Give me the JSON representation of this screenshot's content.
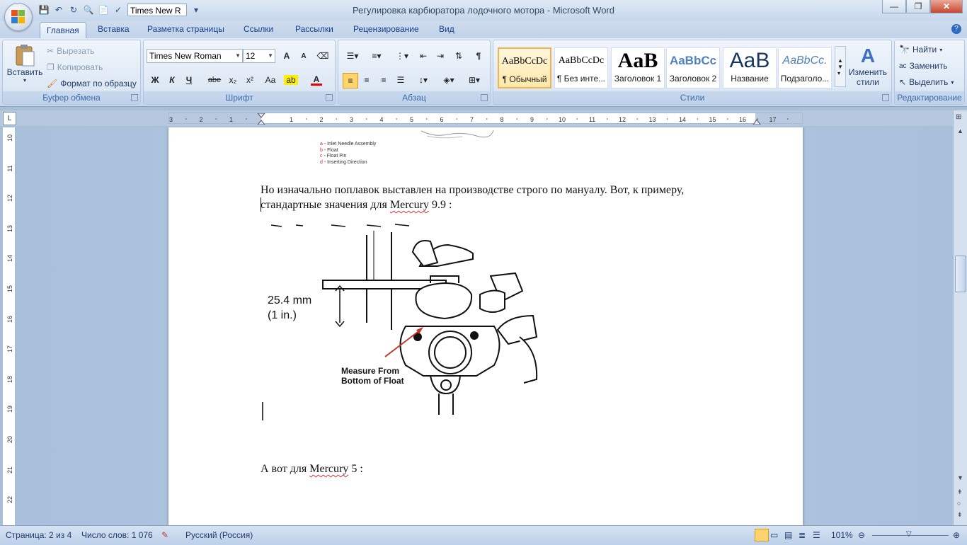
{
  "window": {
    "title": "Регулировка карбюратора лодочного мотора - Microsoft Word",
    "qat_font": "Times New R",
    "controls": [
      "—",
      "❐",
      "✕"
    ]
  },
  "tabs": [
    "Главная",
    "Вставка",
    "Разметка страницы",
    "Ссылки",
    "Рассылки",
    "Рецензирование",
    "Вид"
  ],
  "clipboard": {
    "paste": "Вставить",
    "cut": "Вырезать",
    "copy": "Копировать",
    "format_painter": "Формат по образцу",
    "label": "Буфер обмена"
  },
  "font": {
    "name": "Times New Roman",
    "size": "12",
    "bold": "Ж",
    "italic": "К",
    "underline": "Ч",
    "strike": "abe",
    "subscript": "x₂",
    "superscript": "x²",
    "case": "Aa",
    "grow": "A",
    "shrink": "A",
    "color_letter": "A",
    "label": "Шрифт"
  },
  "paragraph": {
    "label": "Абзац",
    "pilcrow": "¶"
  },
  "styles": {
    "items": [
      {
        "preview": "AaBbCcDc",
        "name": "¶ Обычный"
      },
      {
        "preview": "AaBbCcDc",
        "name": "¶ Без инте..."
      },
      {
        "preview": "AaB",
        "name": "Заголовок 1"
      },
      {
        "preview": "AaBbCc",
        "name": "Заголовок 2"
      },
      {
        "preview": "AaB",
        "name": "Название"
      },
      {
        "preview": "AaBbCc.",
        "name": "Подзаголо..."
      }
    ],
    "change": "Изменить стили",
    "label": "Стили"
  },
  "editing": {
    "find": "Найти",
    "replace": "Заменить",
    "select": "Выделить",
    "label": "Редактирование"
  },
  "ruler": {
    "h_numbers": [
      "3",
      "2",
      "1",
      "1",
      "2",
      "3",
      "4",
      "5",
      "6",
      "7",
      "8",
      "9",
      "10",
      "11",
      "12",
      "13",
      "14",
      "15",
      "16",
      "17"
    ],
    "v_numbers": [
      "10",
      "11",
      "12",
      "13",
      "14",
      "15",
      "16",
      "17",
      "18",
      "19",
      "20",
      "21",
      "22"
    ]
  },
  "document": {
    "legend": [
      "a - Inlet Needle Assembly",
      "b - Float",
      "c - Float Pin",
      "d - Inserting Direction"
    ],
    "legend_letters": [
      "a",
      "b",
      "c",
      "d"
    ],
    "legend_texts": [
      "- Inlet Needle Assembly",
      "- Float",
      "- Float Pin",
      "- Inserting Direction"
    ],
    "para1_line1": "Но изначально поплавок выставлен на производстве строго по мануалу. Вот, к примеру,",
    "para1_line2_pre": "стандартные значения для ",
    "para1_brand": "Mercury",
    "para1_line2_post": " 9.9 :",
    "figure": {
      "dim_mm": "25.4 mm",
      "dim_in": "(1 in.)",
      "caption1": "Measure From",
      "caption2": "Bottom of Float"
    },
    "para2_pre": "А вот для ",
    "para2_brand": "Mercury",
    "para2_post": " 5 :"
  },
  "status": {
    "page": "Страница: 2 из 4",
    "words": "Число слов: 1 076",
    "language": "Русский (Россия)",
    "zoom": "101%"
  }
}
